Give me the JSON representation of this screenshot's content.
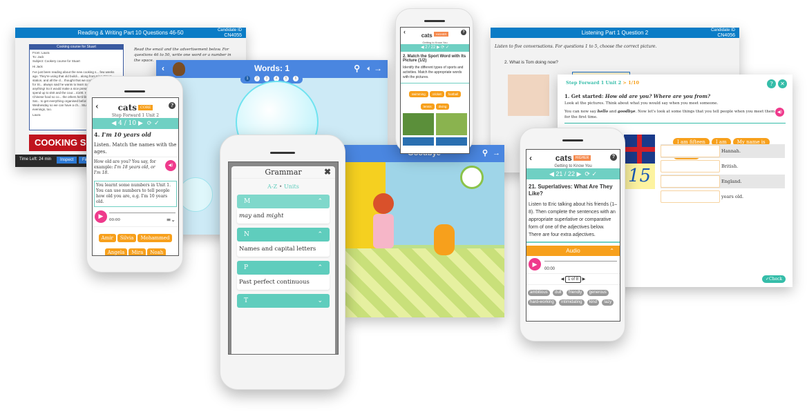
{
  "reading": {
    "title": "Reading & Writing   Part 10   Questions  46-50",
    "candidate_label": "Candidate ID",
    "candidate_id": "CN4055",
    "instructions": "Read the email and the advertisement below. For questions 46 to 50, write one word or a number in the space.",
    "email_title": "Cooking course for Stuart",
    "from_label": "From:",
    "from": "Laura",
    "to_label": "To:",
    "to": "Jack",
    "subject_label": "Subject:",
    "subject": "Cookery course for Stuart",
    "greeting": "Hi Jack",
    "body": "I've just been reading about the new cooking s... few weeks ago. They're using that old buildi... along from King Street station, and all the cl... thought that we could pay for a course for St... always said he wants to learn to cook – he s... anything! So it would make a nice present fo... We said we'd spend up to £50 and the cour... £100. He's not been on Chinese food so co... the others he'd like! As his birthday's on Sat... to get everything organised before that. How... coffee on Wednesday so we can have a ch... Stuart works on Tuesday evenings, too.",
    "sign": "Laura",
    "ad": "COOKING SC",
    "time_left": "Time Left: 24 min",
    "inspect": "Inspect",
    "finish": "Fin"
  },
  "listening": {
    "title": "Listening   Part 1   Question  2",
    "candidate_label": "Candidate ID",
    "candidate_id": "CN4056",
    "instructions": "Listen to five conversations. For questions 1 to 5, choose the correct picture.",
    "question": "2.  What is Tom doing now?"
  },
  "words_game": {
    "title": "Words: 1",
    "steps": [
      "1",
      "2",
      "3",
      "4",
      "5",
      "6"
    ]
  },
  "goodbye_game": {
    "title": "Goodbye"
  },
  "step_forward": {
    "breadcrumb": "Step Forward 1 Unit 2",
    "progress": "> 1/10",
    "q_num": "1.",
    "q_title": "Get started:",
    "q_title_it": "How old are you? Where are you from?",
    "line1": "Look at the pictures. Think about what you would say when you meet someone.",
    "line2a": "You can now say ",
    "hello": "hello",
    "and": " and ",
    "goodbye": "goodbye",
    "line2b": ". Now let's look at some things that you tell people when you meet them for the first time.",
    "chips": [
      "I am fifteen",
      "I am",
      "My name is",
      "I live in"
    ],
    "rows": [
      "Hannah.",
      "British.",
      "England.",
      "years old."
    ],
    "number": "15",
    "check": "✓Check"
  },
  "phone_core": {
    "logo": "cats",
    "badge": "CORE",
    "unit": "Step Forward 1 Unit 2",
    "progress": "4 / 10",
    "q": "4. ",
    "q_title": "I'm 10 years old",
    "instr": "Listen. Match the names with the ages.",
    "prompt_a": "How old are you? You say, for example: ",
    "prompt_it": "I'm 18 years old, or I'm 18.",
    "tip": "You learnt some numbers in Unit 1. You can use numbers to tell people how old you are, e.g. I'm 10 years old.",
    "time": "00:00",
    "names": [
      "Amir",
      "Silvia",
      "Mohammed",
      "Angela",
      "Mira",
      "Noah"
    ]
  },
  "phone_sport": {
    "logo": "cats",
    "badge": "HIGHER",
    "unit": "Getting to Know You",
    "progress": "2 / 22",
    "q": "2. Match the Sport Word with Its Picture (1/2)",
    "instr": "Identify the different types of sports and activities. Match the appropriate words with the pictures.",
    "words": [
      "swimming",
      "cricket",
      "football",
      "tennis",
      "diving"
    ]
  },
  "phone_grammar": {
    "logo": "cats",
    "title": "Grammar",
    "az": "A-Z",
    "dot": " • ",
    "units": "Units",
    "sections": [
      {
        "letter": "M",
        "item_it1": "may",
        "item_mid": " and ",
        "item_it2": "might",
        "open": true
      },
      {
        "letter": "N",
        "item": "Names and capital letters",
        "open": true
      },
      {
        "letter": "P",
        "item": "Past perfect continuous",
        "open": true
      },
      {
        "letter": "T",
        "open": false
      }
    ]
  },
  "phone_super": {
    "logo": "cats",
    "badge": "HIGHER",
    "unit": "Getting to Know You",
    "progress": "21 / 22",
    "q": "21. Superlatives: What Are They Like?",
    "instr": "Listen to Eric talking about his friends (1–8). Then complete the sentences with an appropriate superlative or comparative form of one of the adjectives below. There are four extra adjectives.",
    "audio": "Audio",
    "time": "00:00",
    "pager": "1 of 8",
    "adjectives": [
      "ambitious",
      "dull",
      "friendly",
      "generous",
      "hard-working",
      "intimidating",
      "kind",
      "lazy"
    ]
  },
  "colors": {
    "teal": "#6fd0c3",
    "orange": "#f7a01c",
    "pink": "#ef3a8c",
    "exam_blue": "#0a7cc6",
    "game_blue": "#4a86e0"
  }
}
